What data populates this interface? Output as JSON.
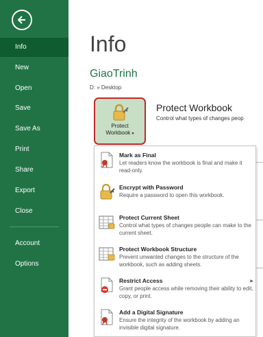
{
  "sidebar": {
    "back_label": "Back",
    "items": [
      {
        "label": "Info",
        "active": true
      },
      {
        "label": "New"
      },
      {
        "label": "Open"
      },
      {
        "label": "Save"
      },
      {
        "label": "Save As"
      },
      {
        "label": "Print"
      },
      {
        "label": "Share"
      },
      {
        "label": "Export"
      },
      {
        "label": "Close"
      },
      {
        "label": "Account"
      },
      {
        "label": "Options"
      }
    ]
  },
  "main": {
    "title": "Info",
    "doc_name": "GiaoTrinh",
    "doc_path": "D: » Desktop",
    "protect": {
      "button_line1": "Protect",
      "button_line2": "Workbook",
      "title": "Protect Workbook",
      "description": "Control what types of changes peop"
    }
  },
  "menu": {
    "items": [
      {
        "title": "Mark as Final",
        "desc": "Let readers know the workbook is final and make it read-only.",
        "icon": "final-document-icon"
      },
      {
        "title": "Encrypt with Password",
        "desc": "Require a password to open this workbook.",
        "icon": "lock-key-icon"
      },
      {
        "title": "Protect Current Sheet",
        "desc": "Control what types of changes people can make to the current sheet.",
        "icon": "sheet-lock-icon"
      },
      {
        "title": "Protect Workbook Structure",
        "desc": "Prevent unwanted changes to the structure of the workbook, such as adding sheets.",
        "icon": "workbook-structure-icon"
      },
      {
        "title": "Restrict Access",
        "desc": "Grant people access while removing their ability to edit, copy, or print.",
        "icon": "restrict-access-icon",
        "has_submenu": true
      },
      {
        "title": "Add a Digital Signature",
        "desc": "Ensure the integrity of the workbook by adding an invisible digital signature.",
        "icon": "digital-signature-icon"
      }
    ]
  },
  "colors": {
    "sidebar": "#217346",
    "sidebar_active": "#0e5c2f",
    "accent_green": "#217346",
    "highlight_border": "#c0282a",
    "button_bg": "#c8dfc6"
  }
}
